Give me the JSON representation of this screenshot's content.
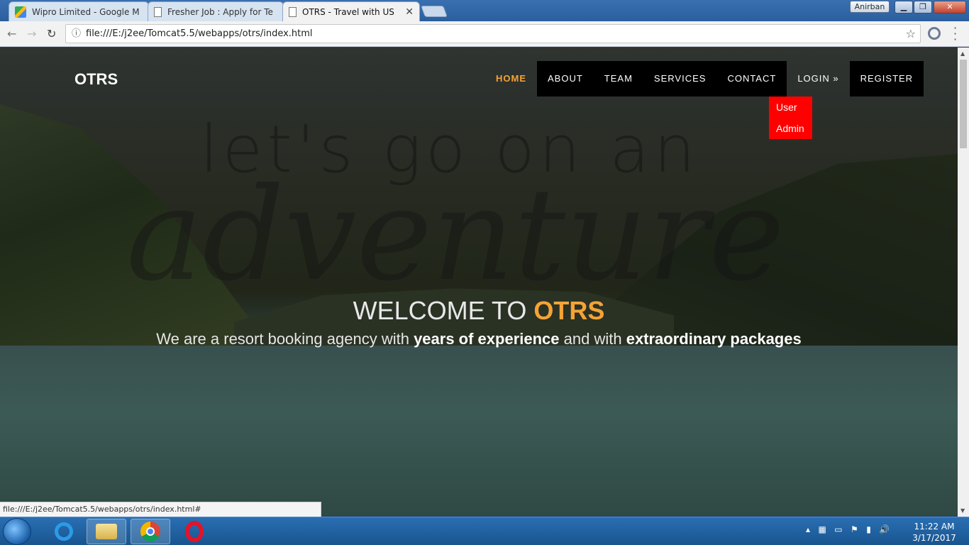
{
  "browser": {
    "tabs": [
      {
        "title": "Wipro Limited - Google M",
        "active": false
      },
      {
        "title": "Fresher Job : Apply for Te",
        "active": false
      },
      {
        "title": "OTRS - Travel with US",
        "active": true
      }
    ],
    "profile_name": "Anirban",
    "address": "file:///E:/j2ee/Tomcat5.5/webapps/otrs/index.html",
    "status_url": "file:///E:/j2ee/Tomcat5.5/webapps/otrs/index.html#"
  },
  "site": {
    "brand": "OTRS",
    "nav": {
      "home": "HOME",
      "about": "ABOUT",
      "team": "TEAM",
      "services": "SERVICES",
      "contact": "CONTACT",
      "login": "LOGIN »",
      "register": "REGISTER"
    },
    "login_menu": {
      "user": "User",
      "admin": "Admin"
    },
    "hero": {
      "script_top": "let's go on an",
      "script_big": "adventure",
      "welcome_prefix": "WELCOME TO ",
      "welcome_accent": "OTRS",
      "tagline_part1": "We are a resort booking agency with ",
      "tagline_bold1": "years of experience",
      "tagline_part2": " and with ",
      "tagline_bold2": "extraordinary packages"
    },
    "colors": {
      "accent": "#f5a336",
      "dropdown": "#ff0000",
      "nav_bg": "#000000"
    }
  },
  "taskbar": {
    "time": "11:22 AM",
    "date": "3/17/2017",
    "icons": [
      "start-orb-icon",
      "internet-explorer-icon",
      "file-explorer-icon",
      "chrome-icon",
      "opera-icon"
    ]
  }
}
